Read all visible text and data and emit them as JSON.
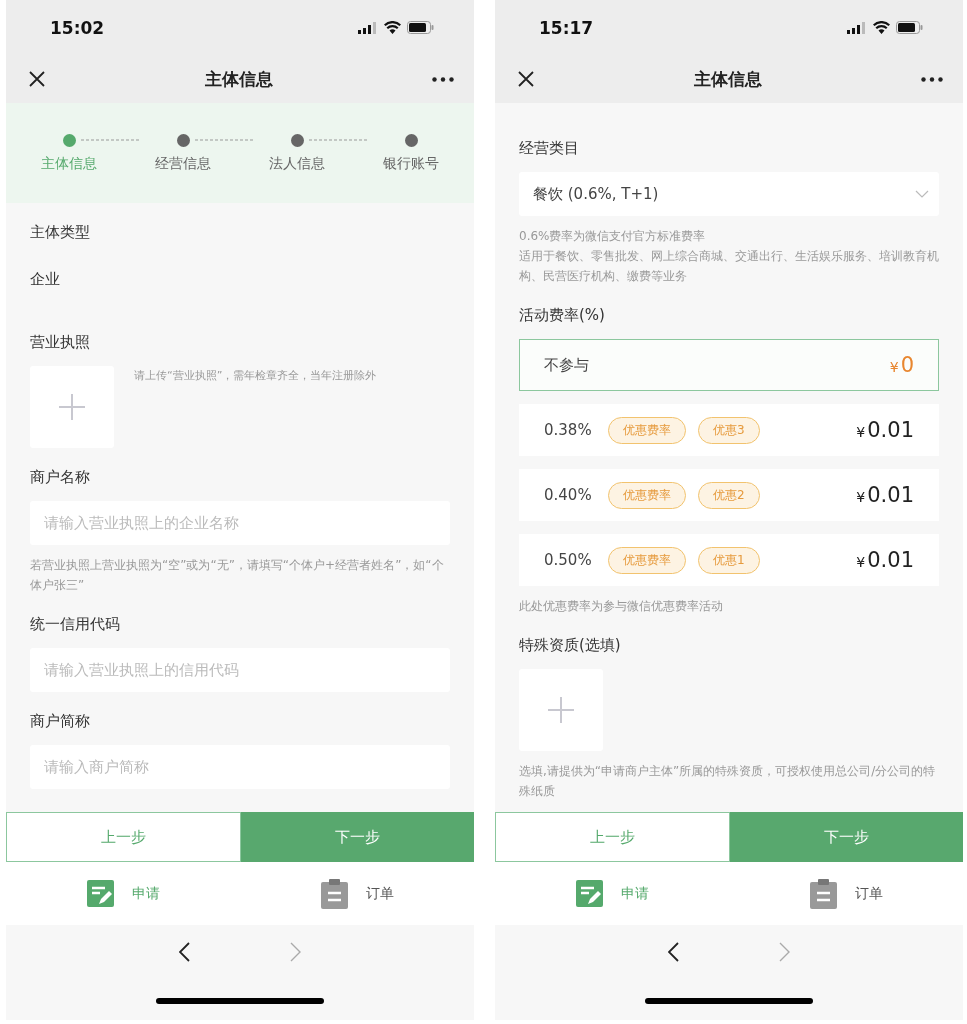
{
  "screens": [
    {
      "status_bar": {
        "time": "15:02"
      },
      "title": "主体信息",
      "steps": [
        {
          "label": "主体信息",
          "selected": true
        },
        {
          "label": "经营信息",
          "selected": false
        },
        {
          "label": "法人信息",
          "selected": false
        },
        {
          "label": "银行账号",
          "selected": false
        }
      ],
      "blocks": [
        {
          "kind": "label",
          "text": "主体类型"
        },
        {
          "kind": "value",
          "text": "企业"
        },
        {
          "kind": "label",
          "text": "营业执照"
        },
        {
          "kind": "upload",
          "hint": "请上传“营业执照”，需年检章齐全，当年注册除外"
        },
        {
          "kind": "label",
          "text": "商户名称"
        },
        {
          "kind": "input",
          "placeholder": "请输入营业执照上的企业名称"
        },
        {
          "kind": "note",
          "lines": [
            "若营业执照上营业执照为“空”或为“无”，请填写“个体户+经营者姓名”，如“个体户张三”"
          ]
        },
        {
          "kind": "label",
          "text": "统一信用代码"
        },
        {
          "kind": "input",
          "placeholder": "请输入营业执照上的信用代码"
        },
        {
          "kind": "label",
          "text": "商户简称"
        },
        {
          "kind": "input",
          "placeholder": "请输入商户简称"
        }
      ],
      "buttons": {
        "prev": "上一步",
        "next": "下一步"
      },
      "tabs": [
        {
          "label": "申请",
          "selected": true
        },
        {
          "label": "订单",
          "selected": false
        }
      ],
      "browser_nav": {
        "forward_disabled": true
      }
    },
    {
      "status_bar": {
        "time": "15:17"
      },
      "title": "主体信息",
      "blocks": [
        {
          "kind": "label",
          "text": "经营类目"
        },
        {
          "kind": "select",
          "value": "餐饮 (0.6%, T+1)"
        },
        {
          "kind": "note",
          "lines": [
            "0.6%费率为微信支付官方标准费率",
            "适用于餐饮、零售批发、网上综合商城、交通出行、生活娱乐服务、培训教育机构、民营医疗机构、缴费等业务"
          ]
        },
        {
          "kind": "label",
          "text": "活动费率(%)"
        },
        {
          "kind": "options",
          "items": [
            {
              "rate": "不参与",
              "currency": "¥",
              "price": "0",
              "selected": true
            },
            {
              "rate": "0.38%",
              "tags": [
                "优惠费率",
                "优惠3"
              ],
              "currency": "¥",
              "price": "0.01",
              "selected": false
            },
            {
              "rate": "0.40%",
              "tags": [
                "优惠费率",
                "优惠2"
              ],
              "currency": "¥",
              "price": "0.01",
              "selected": false
            },
            {
              "rate": "0.50%",
              "tags": [
                "优惠费率",
                "优惠1"
              ],
              "currency": "¥",
              "price": "0.01",
              "selected": false
            }
          ]
        },
        {
          "kind": "note",
          "lines": [
            "此处优惠费率为参与微信优惠费率活动"
          ]
        },
        {
          "kind": "label",
          "text": "特殊资质(选填)"
        },
        {
          "kind": "upload"
        },
        {
          "kind": "note",
          "lines": [
            "选填,请提供为“申请商户主体”所属的特殊资质，可授权使用总公司/分公司的特殊纸质"
          ]
        }
      ],
      "buttons": {
        "prev": "上一步",
        "next": "下一步"
      },
      "tabs": [
        {
          "label": "申请",
          "selected": true
        },
        {
          "label": "订单",
          "selected": false
        }
      ],
      "browser_nav": {
        "forward_disabled": true
      }
    }
  ]
}
